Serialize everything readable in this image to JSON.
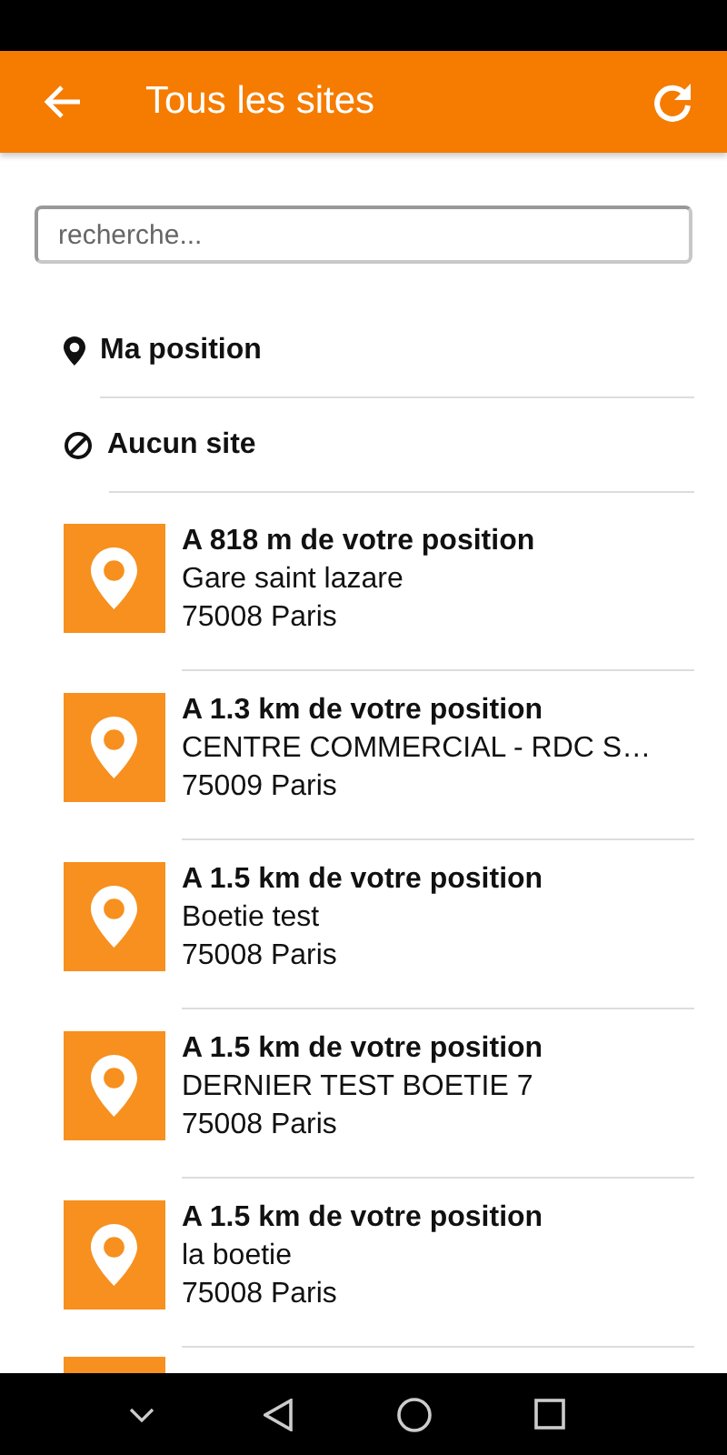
{
  "app_bar": {
    "title": "Tous les sites"
  },
  "search": {
    "placeholder": "recherche..."
  },
  "options": [
    {
      "kind": "position",
      "label": "Ma position"
    },
    {
      "kind": "none",
      "label": "Aucun site"
    }
  ],
  "sites": [
    {
      "distance": "A 818 m de votre position",
      "name": "Gare saint lazare",
      "city": "75008 Paris"
    },
    {
      "distance": "A 1.3 km de votre position",
      "name": "CENTRE COMMERCIAL - RDC S…",
      "city": "75009 Paris"
    },
    {
      "distance": "A 1.5 km de votre position",
      "name": "Boetie test",
      "city": "75008 Paris"
    },
    {
      "distance": "A 1.5 km de votre position",
      "name": "DERNIER TEST BOETIE 7",
      "city": "75008 Paris"
    },
    {
      "distance": "A 1.5 km de votre position",
      "name": "la boetie",
      "city": "75008 Paris"
    }
  ]
}
